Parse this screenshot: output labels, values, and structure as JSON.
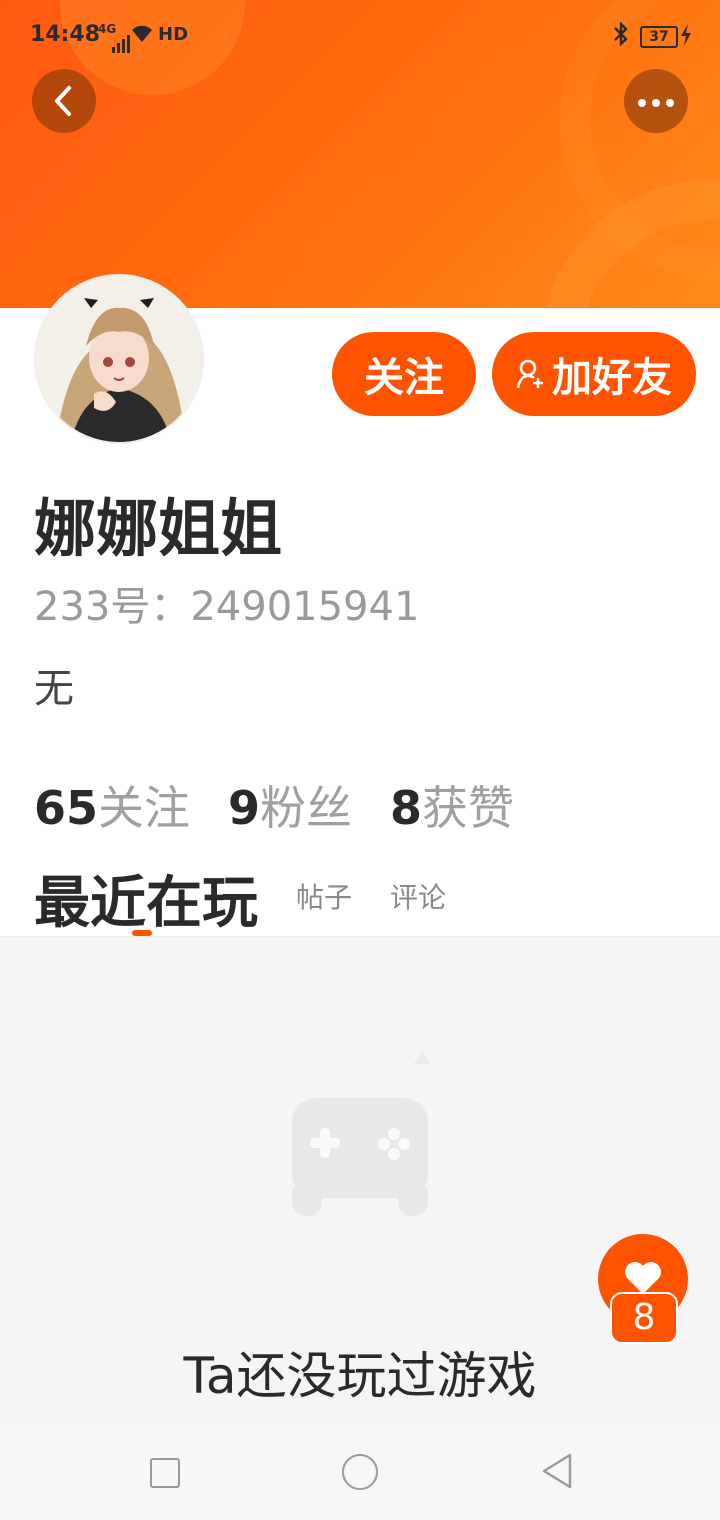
{
  "status_bar": {
    "time": "14:48",
    "network": "4G",
    "hd_label": "HD",
    "battery": "37"
  },
  "header": {
    "back_icon": "chevron-left-icon",
    "more_icon": "more-horizontal-icon"
  },
  "profile": {
    "name": "娜娜姐姐",
    "id_text": "233号：249015941",
    "bio": "无",
    "follow_label": "关注",
    "add_friend_label": "加好友",
    "stats": [
      {
        "value": "65",
        "label": "关注"
      },
      {
        "value": "9",
        "label": "粉丝"
      },
      {
        "value": "8",
        "label": "获赞"
      }
    ]
  },
  "tabs": {
    "active": "最近在玩",
    "items": [
      "帖子",
      "评论"
    ]
  },
  "empty_state": {
    "icon": "gamepad-icon",
    "text": "Ta还没玩过游戏"
  },
  "like_button": {
    "icon": "heart-icon",
    "count": "8"
  },
  "colors": {
    "accent": "#ff5300",
    "banner": "#ff6a0e",
    "content_bg": "#f5f5f5"
  },
  "nav": {
    "recent_icon": "square-icon",
    "home_icon": "circle-icon",
    "back_icon": "triangle-back-icon"
  }
}
